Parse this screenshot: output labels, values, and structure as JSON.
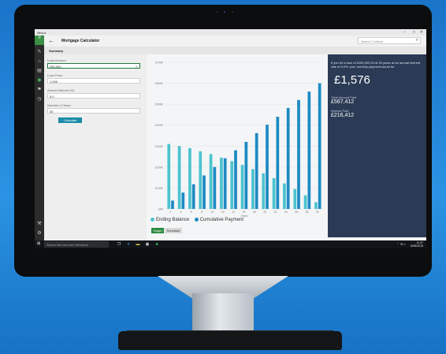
{
  "app": {
    "window_title": "Mitsuz",
    "title": "Mortgage Calculator",
    "tab": "Summary"
  },
  "search": {
    "placeholder": "Search Cortana"
  },
  "form": {
    "loan_amount_label": "Loan Amount",
    "loan_amount_value": "250,000",
    "loan_fees_label": "Loan Fees",
    "loan_fees_value": "1,000",
    "interest_label": "Annual Interest (%)",
    "interest_value": "5.0",
    "years_label": "Number of Years",
    "years_value": "30",
    "calculate_label": "Calculate"
  },
  "results": {
    "intro": "If you let a loan of £250,000.00 at 30 years at an annual interest rate of 5.0%, your monthly payment would be:",
    "monthly_payment": "£1,576",
    "total_amount_label": "Total Amount Paid",
    "total_amount_value": "£567,412",
    "interest_paid_label": "Interest Paid",
    "interest_paid_value": "£216,412"
  },
  "buttons": {
    "graph": "Graph",
    "schedule": "Schedule"
  },
  "taskbar": {
    "search_placeholder": "Search the web and Windows",
    "time": "11:27",
    "date": "8/06/2015"
  },
  "chart_data": {
    "type": "bar",
    "xlabel": "Years",
    "ylabel": "",
    "y_ticks": [
      "£0K",
      "£100K",
      "£200K",
      "£300K",
      "£400K",
      "£500K",
      "£600K",
      "£700K"
    ],
    "ylim": [
      0,
      700000
    ],
    "categories": [
      "2",
      "4",
      "6",
      "8",
      "10",
      "12",
      "14",
      "16",
      "18",
      "20",
      "22",
      "24",
      "26",
      "28",
      "30"
    ],
    "series": [
      {
        "name": "Ending Balance",
        "color": "#4cc3cf",
        "values": [
          310000,
          300000,
          290000,
          275000,
          262000,
          245000,
          228000,
          210000,
          190000,
          170000,
          147000,
          122000,
          95000,
          65000,
          32000
        ]
      },
      {
        "name": "Cumulative Payment",
        "color": "#1d8ac3",
        "values": [
          40000,
          78000,
          118000,
          160000,
          200000,
          242000,
          280000,
          320000,
          362000,
          402000,
          440000,
          482000,
          520000,
          560000,
          600000
        ]
      }
    ]
  }
}
